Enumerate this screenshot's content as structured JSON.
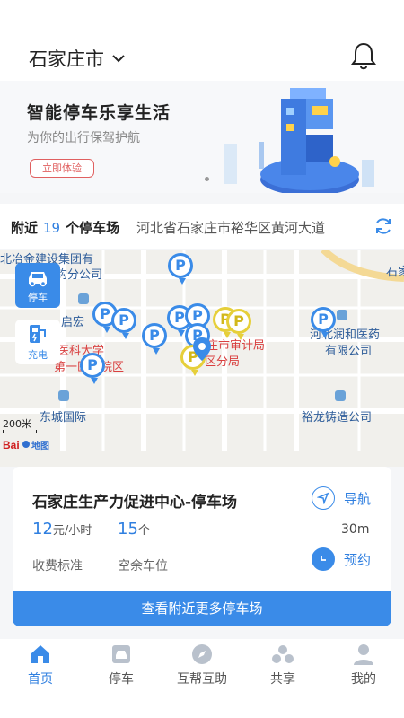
{
  "header": {
    "city": "石家庄市"
  },
  "banner": {
    "title": "智能停车乐享生活",
    "subtitle": "为你的出行保驾护航",
    "button": "立即体验"
  },
  "nearby": {
    "prefix": "附近",
    "count": "19",
    "suffix": "个停车场",
    "address": "河北省石家庄市裕华区黄河大道"
  },
  "map": {
    "labels": {
      "l1": "北冶金建设集团有",
      "l2": "钩分公司",
      "l3": "石家",
      "l4": "启宏",
      "l5": "医科大学",
      "l6": "第一医院",
      "l7": "院区",
      "l8": "庄市审计局",
      "l9": "区分局",
      "l10": "河北润和医药",
      "l11": "有限公司",
      "l12": "东城国际",
      "l13": "裕龙铸造公司"
    },
    "pin_letter": "P",
    "park_button": "停车",
    "charge_button": "充电",
    "scale": "200米",
    "logo": "Baidu地图"
  },
  "card": {
    "title": "石家庄生产力促进中心-停车场",
    "price_value": "12",
    "price_unit": "元/小时",
    "spaces_value": "15",
    "spaces_unit": "个",
    "distance": "30m",
    "price_label": "收费标准",
    "spaces_label": "空余车位",
    "navigate": "导航",
    "reserve": "预约",
    "more": "查看附近更多停车场"
  },
  "tabs": [
    {
      "label": "首页",
      "icon": "home-icon"
    },
    {
      "label": "停车",
      "icon": "car-icon"
    },
    {
      "label": "互帮互助",
      "icon": "compass-icon"
    },
    {
      "label": "共享",
      "icon": "share-icon"
    },
    {
      "label": "我的",
      "icon": "person-icon"
    }
  ],
  "colors": {
    "accent": "#3a8be8",
    "text_blue": "#2f7fe0",
    "pin_yellow": "#e6cf3a",
    "banner_red": "#e06060"
  }
}
